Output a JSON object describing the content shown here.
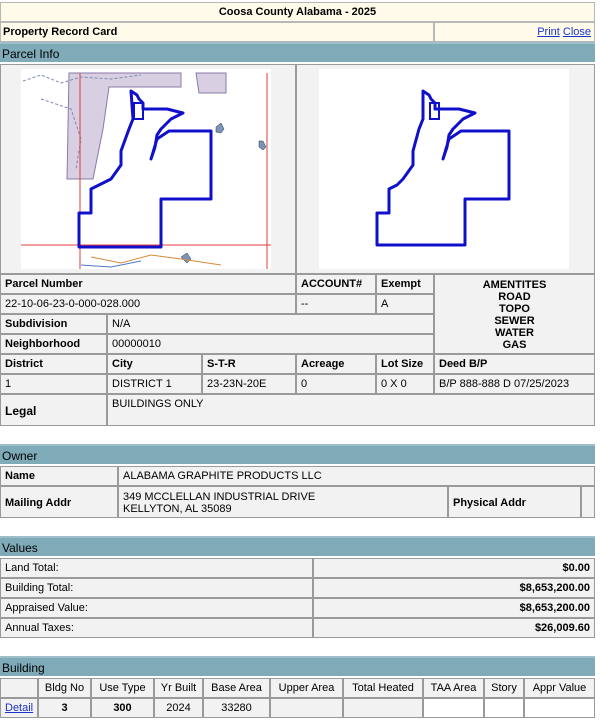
{
  "header": {
    "title": "Coosa County Alabama - 2025",
    "subtitle": "Property Record Card",
    "print": "Print",
    "close": "Close"
  },
  "parcel": {
    "section": "Parcel Info",
    "labels": {
      "parcel_number": "Parcel Number",
      "account": "ACCOUNT#",
      "exempt": "Exempt",
      "subdivision": "Subdivision",
      "neighborhood": "Neighborhood",
      "district": "District",
      "city": "City",
      "str": "S-T-R",
      "acreage": "Acreage",
      "lot_size": "Lot Size",
      "deed": "Deed B/P",
      "legal": "Legal"
    },
    "values": {
      "parcel_number": "22-10-06-23-0-000-028.000",
      "account": "--",
      "exempt": "A",
      "subdivision": "N/A",
      "neighborhood": "00000010",
      "district": "1",
      "city": "DISTRICT 1",
      "str": "23-23N-20E",
      "acreage": "0",
      "lot_size": "0 X 0",
      "deed": "B/P 888-888 D 07/25/2023",
      "legal": "BUILDINGS ONLY"
    },
    "amenities": {
      "title": "AMENTITES",
      "items": [
        "ROAD",
        "TOPO",
        "SEWER",
        "WATER",
        "GAS"
      ]
    }
  },
  "owner": {
    "section": "Owner",
    "name_label": "Name",
    "name": "ALABAMA GRAPHITE PRODUCTS LLC",
    "mailing_label": "Mailing Addr",
    "mailing_line1": "349 MCCLELLAN INDUSTRIAL DRIVE",
    "mailing_line2": "KELLYTON, AL  35089",
    "physical_label": "Physical Addr",
    "physical": ""
  },
  "values": {
    "section": "Values",
    "rows": [
      {
        "label": "Land Total:",
        "value": "$0.00"
      },
      {
        "label": "Building Total:",
        "value": "$8,653,200.00"
      },
      {
        "label": "Appraised Value:",
        "value": "$8,653,200.00"
      },
      {
        "label": "Annual Taxes:",
        "value": "$26,009.60"
      }
    ]
  },
  "building": {
    "section": "Building",
    "headers": [
      "",
      "Bldg No",
      "Use Type",
      "Yr Built",
      "Base Area",
      "Upper Area",
      "Total Heated",
      "TAA Area",
      "Story",
      "Appr Value"
    ],
    "rows": [
      {
        "detail": "Detail",
        "cells": [
          "3",
          "300",
          "2024",
          "33280",
          "",
          "",
          "",
          "",
          ""
        ]
      }
    ]
  },
  "colors": {
    "section_bar": "#7fabb9",
    "header_bg": "#fffaea",
    "parcel_outline": "#1010cc",
    "link": "#1a33c5"
  }
}
